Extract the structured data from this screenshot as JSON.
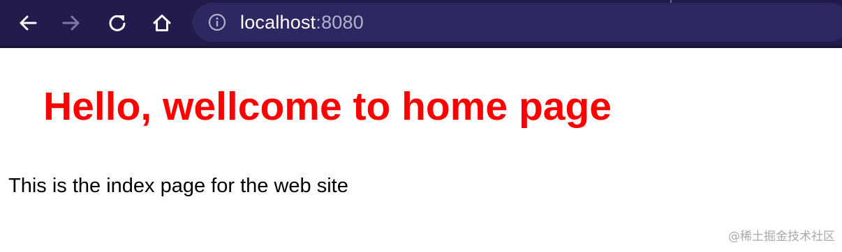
{
  "browser": {
    "url_host": "localhost",
    "url_port": ":8080",
    "icons": {
      "back": "back-arrow-icon",
      "forward": "forward-arrow-icon",
      "reload": "reload-icon",
      "home": "home-icon",
      "site_info": "info-icon"
    },
    "colors": {
      "toolbar_bg": "#221c4d",
      "urlbar_bg": "#2e2862"
    }
  },
  "page": {
    "heading": "Hello, wellcome to home page",
    "paragraph": "This is the index page for the web site",
    "heading_color": "#ff0000"
  },
  "watermark": "@稀土掘金技术社区"
}
